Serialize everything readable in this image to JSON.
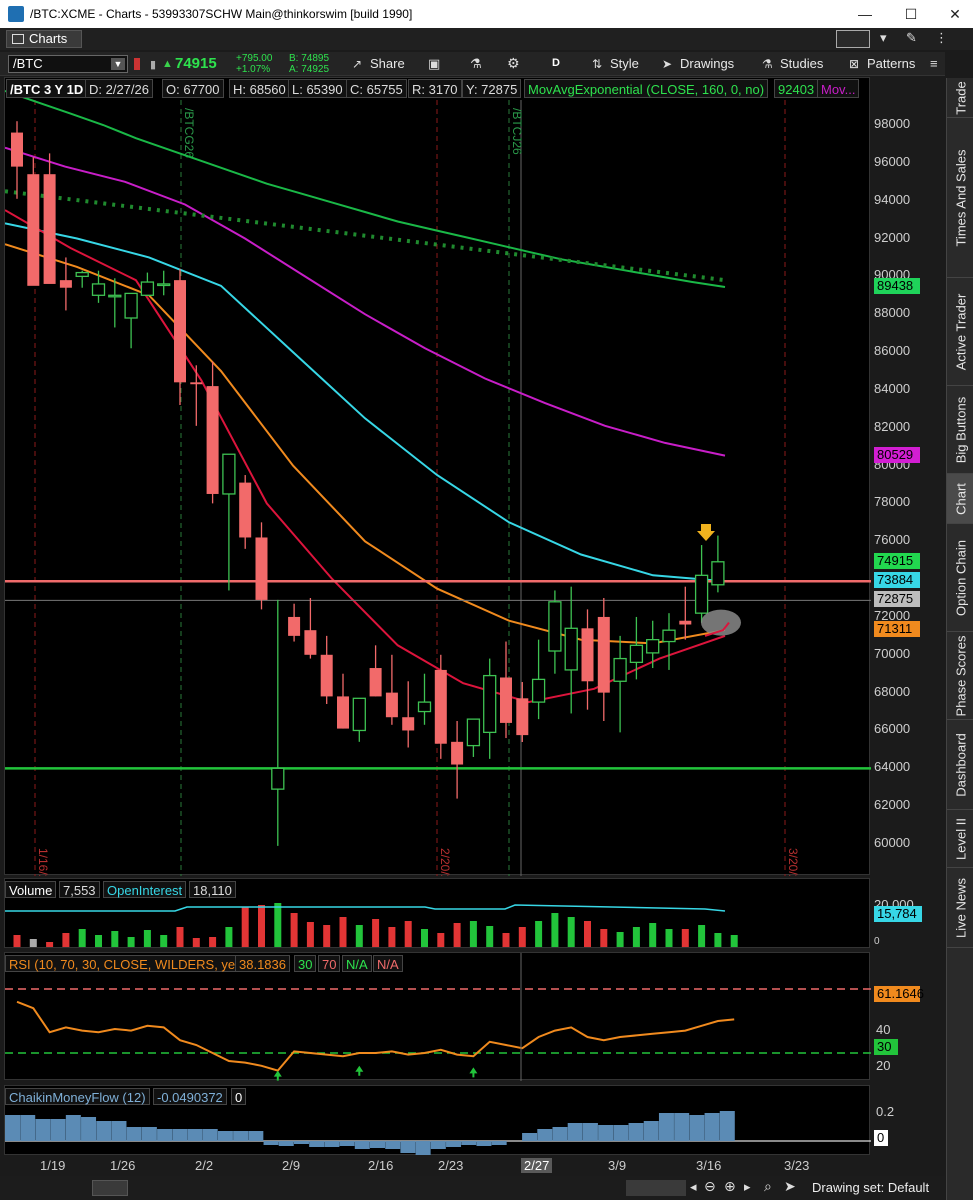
{
  "window": {
    "title": "/BTC:XCME - Charts - 53993307SCHW Main@thinkorswim [build 1990]",
    "min_label": "—",
    "max_label": "☐",
    "close_label": "✕"
  },
  "menu": {
    "charts_tab": "Charts"
  },
  "toolbar": {
    "symbol": "/BTC",
    "last_price": "74915",
    "change": "+795.00",
    "change_pct": "+1.07%",
    "bid": "B: 74895",
    "ask": "A: 74925",
    "share": "Share",
    "aggregation": "D",
    "style": "Style",
    "drawings": "Drawings",
    "studies": "Studies",
    "patterns": "Patterns"
  },
  "header": {
    "desc": "/BTC 3 Y 1D",
    "date": "D: 2/27/26",
    "open": "O: 67700",
    "high": "H: 68560",
    "low": "L: 65390",
    "close": "C: 65755",
    "range": "R: 3170",
    "y": "Y: 72875",
    "study": "MovAvgExponential (CLOSE, 160, 0, no)",
    "study_val": "92403",
    "study_more": "Mov..."
  },
  "price_axis": {
    "labels": [
      "98000",
      "96000",
      "94000",
      "92000",
      "90000",
      "88000",
      "86000",
      "84000",
      "82000",
      "80000",
      "78000",
      "76000",
      "74000",
      "72000",
      "70000",
      "68000",
      "66000",
      "64000",
      "62000",
      "60000"
    ],
    "highlighted": [
      {
        "value": "89438",
        "color": "#1fd35a"
      },
      {
        "value": "80529",
        "color": "#d21ed2"
      },
      {
        "value": "74915",
        "color": "#22d84f"
      },
      {
        "value": "73884",
        "color": "#37d7e6"
      },
      {
        "value": "72875",
        "color": "#bdbdbd"
      },
      {
        "value": "71311",
        "color": "#f08a1e"
      }
    ]
  },
  "date_markers": [
    "1/16/26",
    "/BTCG26",
    "2/20/26",
    "/BTCJ26",
    "3/20/26"
  ],
  "chart_data": {
    "type": "candlestick",
    "dates": [
      "1/14",
      "1/15",
      "1/16",
      "1/20",
      "1/21",
      "1/22",
      "1/23",
      "1/26",
      "1/27",
      "1/28",
      "1/29",
      "1/30",
      "2/2",
      "2/3",
      "2/4",
      "2/5",
      "2/6",
      "2/9",
      "2/10",
      "2/11",
      "2/12",
      "2/13",
      "2/16",
      "2/17",
      "2/18",
      "2/19",
      "2/20",
      "2/23",
      "2/24",
      "2/25",
      "2/26",
      "2/27",
      "3/2",
      "3/3",
      "3/4",
      "3/5",
      "3/6",
      "3/9",
      "3/10",
      "3/11",
      "3/12",
      "3/13",
      "3/16",
      "3/17"
    ],
    "open": [
      97600,
      95400,
      95400,
      89800,
      90000,
      89000,
      89000,
      87800,
      89000,
      89600,
      89800,
      84400,
      84200,
      78500,
      79100,
      76200,
      62900,
      72000,
      71300,
      70000,
      67800,
      66000,
      69300,
      68000,
      66700,
      67000,
      69200,
      65400,
      65200,
      65900,
      68800,
      67700,
      67500,
      70200,
      69200,
      71400,
      72000,
      68600,
      69600,
      70100,
      70700,
      71800,
      72200,
      73700
    ],
    "high": [
      98200,
      96300,
      96500,
      91000,
      90300,
      90300,
      89900,
      88900,
      90200,
      90300,
      90400,
      85300,
      85500,
      80000,
      79500,
      77000,
      72900,
      72700,
      73000,
      71000,
      69000,
      66900,
      70500,
      70000,
      68600,
      69000,
      70000,
      66500,
      66300,
      69800,
      70700,
      68560,
      70800,
      73400,
      73600,
      72400,
      73000,
      71000,
      72000,
      71800,
      72200,
      73600,
      75800,
      76300
    ],
    "low": [
      94100,
      89600,
      89800,
      88200,
      89400,
      88600,
      87300,
      86200,
      89000,
      89000,
      83200,
      82100,
      78000,
      73400,
      75600,
      72400,
      59900,
      70700,
      69800,
      67400,
      66100,
      65400,
      67800,
      66300,
      65100,
      66300,
      64500,
      62400,
      64600,
      64500,
      65600,
      65390,
      66600,
      69000,
      66900,
      67100,
      66500,
      65900,
      68700,
      69300,
      69200,
      70800,
      71700,
      73300
    ],
    "close": [
      95800,
      89500,
      89600,
      89400,
      90200,
      89600,
      89000,
      89100,
      89700,
      89600,
      84400,
      84300,
      78500,
      80600,
      76200,
      72900,
      64000,
      71000,
      70000,
      67800,
      66100,
      67700,
      67800,
      66700,
      66000,
      67500,
      65300,
      64200,
      66600,
      68900,
      66400,
      65755,
      68700,
      72800,
      71400,
      68600,
      68000,
      69800,
      70500,
      70800,
      71300,
      71600,
      74200,
      74915
    ],
    "series": [
      {
        "name": "EMA 160",
        "color": "#1ab847",
        "values": [
          99800,
          99200,
          98600,
          98000,
          97300,
          96700,
          96100,
          95500,
          94900,
          94400,
          93900,
          93400,
          92900,
          92500,
          92100,
          91700,
          91300,
          90900,
          90600,
          90300,
          90000,
          89700,
          89438
        ]
      },
      {
        "name": "EMA magenta",
        "color": "#c81ec8",
        "values": [
          96800,
          95800,
          95000,
          93800,
          92000,
          90000,
          88000,
          86200,
          84600,
          83300,
          82100,
          81200,
          80529
        ]
      },
      {
        "name": "EMA cyan",
        "color": "#37d7e6",
        "values": [
          92800,
          92000,
          91000,
          89500,
          86000,
          82500,
          79500,
          77000,
          75300,
          74200,
          73884
        ]
      },
      {
        "name": "EMA orange",
        "color": "#f08a1e",
        "values": [
          91700,
          90500,
          89000,
          85000,
          80000,
          76000,
          73500,
          71800,
          70800,
          70600,
          71311
        ]
      },
      {
        "name": "EMA red",
        "color": "#dc143c",
        "values": [
          93500,
          91500,
          89800,
          84500,
          78000,
          74000,
          70500,
          68500,
          67500,
          68200,
          69800,
          71000
        ]
      }
    ],
    "hlines": [
      {
        "value": 73884,
        "color": "#f06b6b"
      },
      {
        "value": 64000,
        "color": "#22c43b"
      }
    ],
    "ylim": [
      59000,
      100000
    ]
  },
  "volume_panel": {
    "label": "Volume",
    "value": "7,553",
    "oi_label": "OpenInterest",
    "oi_value": "18,110",
    "axis_top": "20,000",
    "axis_zero": "0",
    "oi_box": "15,784"
  },
  "rsi_panel": {
    "label": "RSI (10, 70, 30, CLOSE, WILDERS, yes)",
    "value": "38.1836",
    "ob": "30",
    "os": "70",
    "na1": "N/A",
    "na2": "N/A",
    "box_value": "61.1646",
    "axis": [
      "40",
      "20"
    ],
    "box_30": "30"
  },
  "cmf_panel": {
    "label": "ChaikinMoneyFlow (12)",
    "value": "-0.0490372",
    "zero": "0",
    "axis_top": "0.2",
    "box_zero": "0"
  },
  "x_axis": [
    "1/19",
    "1/26",
    "2/2",
    "2/9",
    "2/16",
    "2/23",
    "2/27",
    "3/9",
    "3/16",
    "3/23"
  ],
  "sidebar": [
    "Trade",
    "Times And Sales",
    "Active Trader",
    "Big Buttons",
    "Chart",
    "Option Chain",
    "Phase Scores",
    "Dashboard",
    "Level II",
    "Live News"
  ],
  "footer": {
    "drawing_set": "Drawing set: Default"
  }
}
